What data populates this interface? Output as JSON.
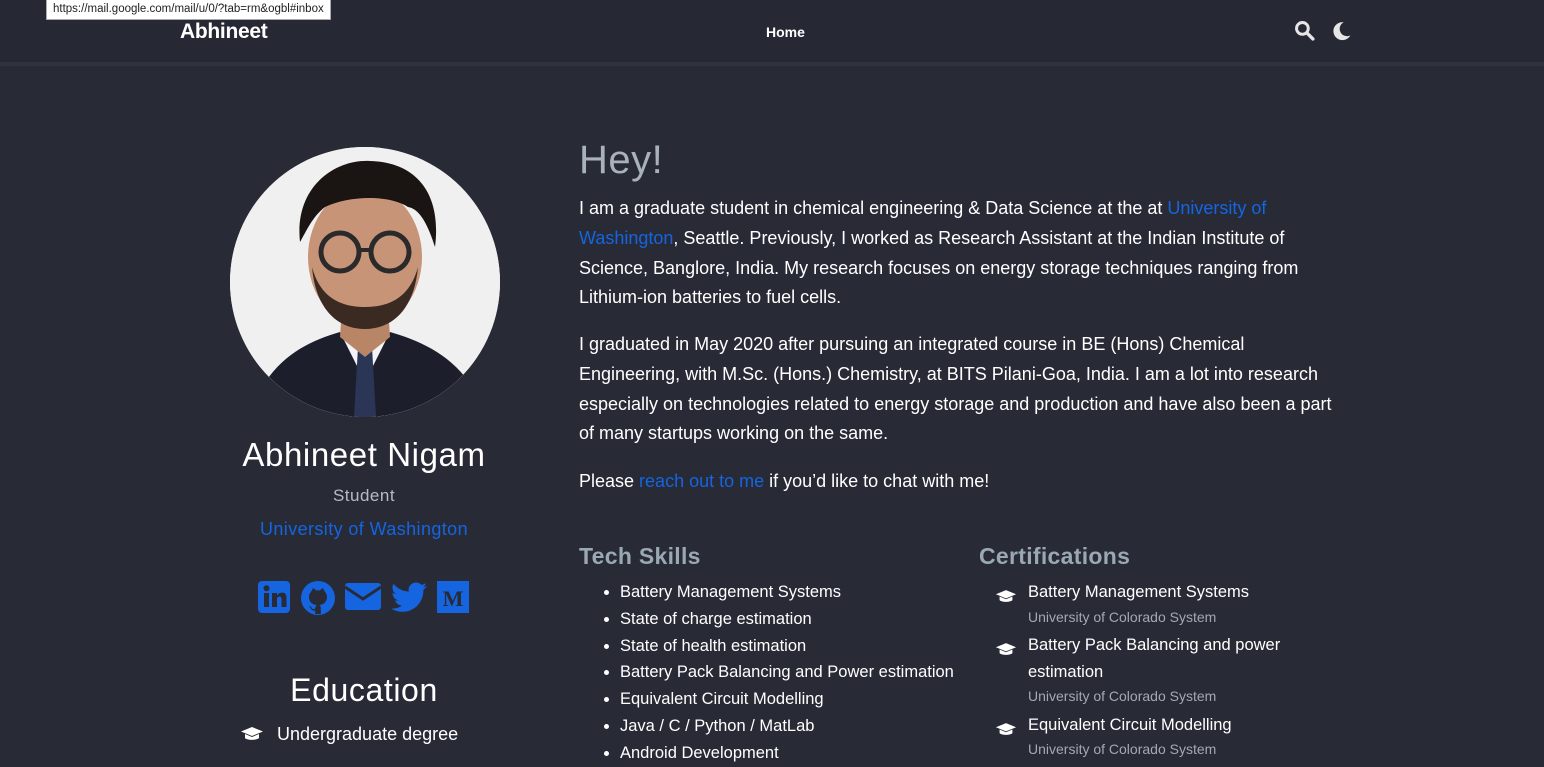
{
  "status_bar": {
    "url": "https://mail.google.com/mail/u/0/?tab=rm&ogbl#inbox"
  },
  "navbar": {
    "brand": "Abhineet",
    "home_label": "Home",
    "icons": [
      "search-icon",
      "moon-icon"
    ]
  },
  "profile": {
    "name": "Abhineet Nigam",
    "role": "Student",
    "organization": "University of Washington",
    "socials": [
      "linkedin-icon",
      "github-icon",
      "email-icon",
      "twitter-icon",
      "medium-icon"
    ]
  },
  "education": {
    "heading": "Education",
    "items": [
      {
        "degree": "Undergraduate degree"
      }
    ]
  },
  "intro": {
    "heading": "Hey!",
    "p1": {
      "before": "I am a graduate student in chemical engineering & Data Science at the at ",
      "link": "University of Washington",
      "after": ", Seattle. Previously, I worked as Research Assistant at the Indian Institute of Science, Banglore, India. My research focuses on energy storage techniques ranging from Lithium-ion batteries to fuel cells."
    },
    "p2": "I graduated in May 2020 after pursuing an integrated course in BE (Hons) Chemical Engineering, with M.Sc. (Hons.) Chemistry, at BITS Pilani-Goa, India. I am a lot into research especially on technologies related to energy storage and production and have also been a part of many startups working on the same.",
    "p3": {
      "before": "Please ",
      "link": "reach out to me",
      "after": " if you’d like to chat with me!"
    }
  },
  "tech_skills": {
    "heading": "Tech Skills",
    "items": [
      "Battery Management Systems",
      "State of charge estimation",
      "State of health estimation",
      "Battery Pack Balancing and Power estimation",
      "Equivalent Circuit Modelling",
      "Java / C / Python / MatLab",
      "Android Development"
    ]
  },
  "certifications": {
    "heading": "Certifications",
    "items": [
      {
        "title": "Battery Management Systems",
        "issuer": "University of Colorado System"
      },
      {
        "title": "Battery Pack Balancing and power estimation",
        "issuer": "University of Colorado System"
      },
      {
        "title": "Equivalent Circuit Modelling",
        "issuer": "University of Colorado System"
      }
    ]
  },
  "colors": {
    "background": "#282a36",
    "navbar": "#262833",
    "link": "#1565e0",
    "heading_muted": "#9aa8b4",
    "text": "#ffffff"
  }
}
